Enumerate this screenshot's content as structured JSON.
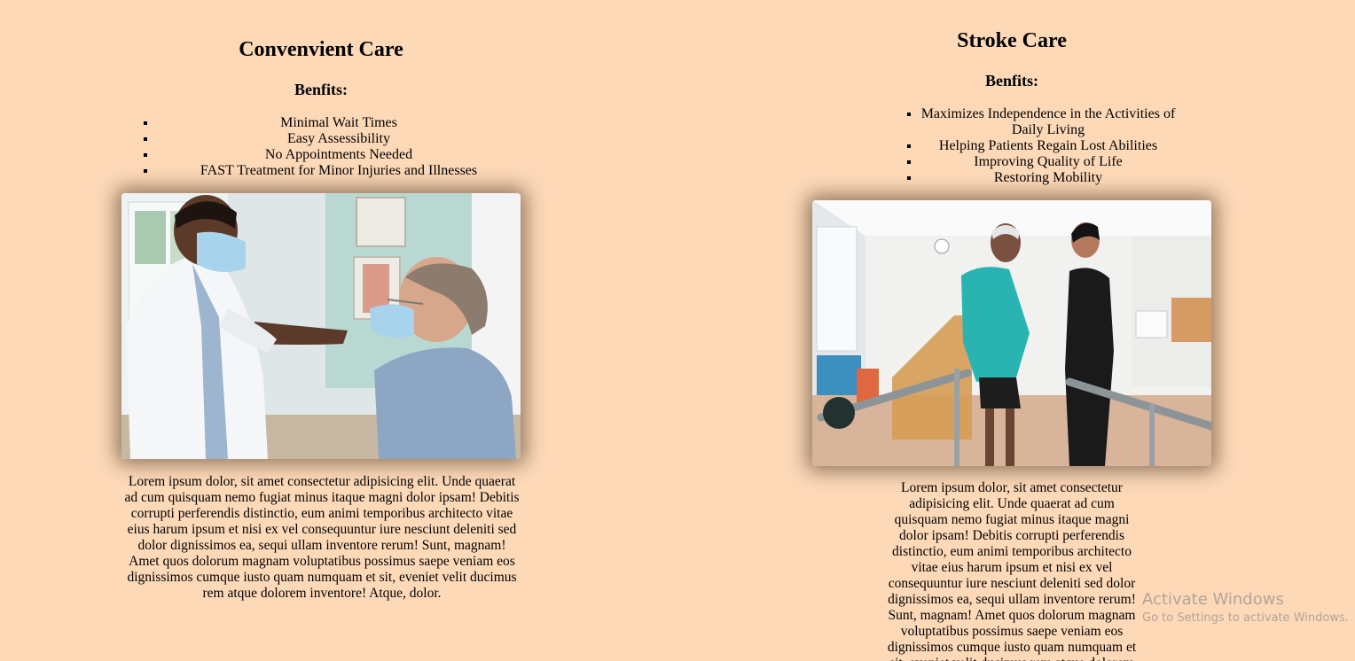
{
  "cards": [
    {
      "title": "Convenvient Care",
      "benefits_heading": "Benfits:",
      "benefits": [
        "Minimal Wait Times",
        "Easy Assessibility",
        "No Appointments Needed",
        "FAST Treatment for Minor Injuries and Illnesses"
      ],
      "image_alt": "doctor examining patient",
      "description": "Lorem ipsum dolor, sit amet consectetur adipisicing elit. Unde quaerat ad cum quisquam nemo fugiat minus itaque magni dolor ipsam! Debitis corrupti perferendis distinctio, eum animi temporibus architecto vitae eius harum ipsum et nisi ex vel consequuntur iure nesciunt deleniti sed dolor dignissimos ea, sequi ullam inventore rerum! Sunt, magnam! Amet quos dolorum magnam voluptatibus possimus saepe veniam eos dignissimos cumque iusto quam numquam et sit, eveniet velit ducimus rem atque dolorem inventore! Atque, dolor."
    },
    {
      "title": "Stroke Care",
      "benefits_heading": "Benfits:",
      "benefits": [
        "Maximizes Independence in the Activities of Daily Living",
        "Helping Patients Regain Lost Abilities",
        "Improving Quality of Life",
        "Restoring Mobility"
      ],
      "image_alt": "therapist assisting patient at parallel bars",
      "description": "Lorem ipsum dolor, sit amet consectetur adipisicing elit. Unde quaerat ad cum quisquam nemo fugiat minus itaque magni dolor ipsam! Debitis corrupti perferendis distinctio, eum animi temporibus architecto vitae eius harum ipsum et nisi ex vel consequuntur iure nesciunt deleniti sed dolor dignissimos ea, sequi ullam inventore rerum! Sunt, magnam! Amet quos dolorum magnam voluptatibus possimus saepe veniam eos dignissimos cumque iusto quam numquam et sit, eveniet velit ducimus rem atque dolorem inventore! Atque, dolor."
    }
  ],
  "watermark": {
    "title": "Activate Windows",
    "subtitle": "Go to Settings to activate Windows."
  },
  "colors": {
    "background": "#fdd9b8"
  }
}
